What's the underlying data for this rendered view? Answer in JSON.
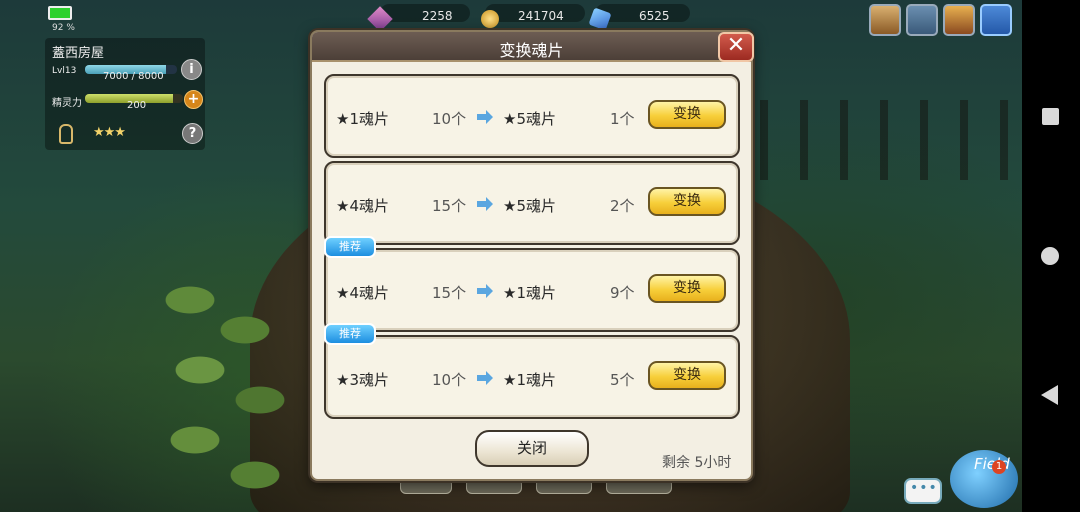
{
  "status": {
    "battery_pct": "92 %"
  },
  "player": {
    "name": "蓋西房屋",
    "level_label": "Lvl13",
    "exp_text": "7000 / 8000",
    "exp_ratio": 0.875,
    "spirit_label": "精灵力",
    "spirit_value": "200",
    "spirit_ratio": 0.9,
    "stars": "★★★"
  },
  "currencies": [
    {
      "icon": "crystal-icon",
      "value": "2258"
    },
    {
      "icon": "gold-coin-icon",
      "value": "241704"
    },
    {
      "icon": "gem-icon",
      "value": "6525"
    }
  ],
  "dialog": {
    "title": "变换魂片",
    "close_symbol": "✕",
    "rows": [
      {
        "badge": "",
        "from_item": "★1魂片",
        "from_qty": "10个",
        "to_item": "★5魂片",
        "to_qty": "1个",
        "button": "变换"
      },
      {
        "badge": "",
        "from_item": "★4魂片",
        "from_qty": "15个",
        "to_item": "★5魂片",
        "to_qty": "2个",
        "button": "变换"
      },
      {
        "badge": "推荐",
        "from_item": "★4魂片",
        "from_qty": "15个",
        "to_item": "★1魂片",
        "to_qty": "9个",
        "button": "变换"
      },
      {
        "badge": "推荐",
        "from_item": "★3魂片",
        "from_qty": "10个",
        "to_item": "★1魂片",
        "to_qty": "5个",
        "button": "变换"
      }
    ],
    "close_button": "关闭",
    "remaining": "剩余  5小时"
  },
  "field": {
    "label": "Field",
    "badge": "1"
  },
  "colors": {
    "convert_button": "#f7cf3a",
    "badge_blue": "#1d8ee0",
    "header_brown": "#5a4b43",
    "close_red": "#b83c30"
  }
}
